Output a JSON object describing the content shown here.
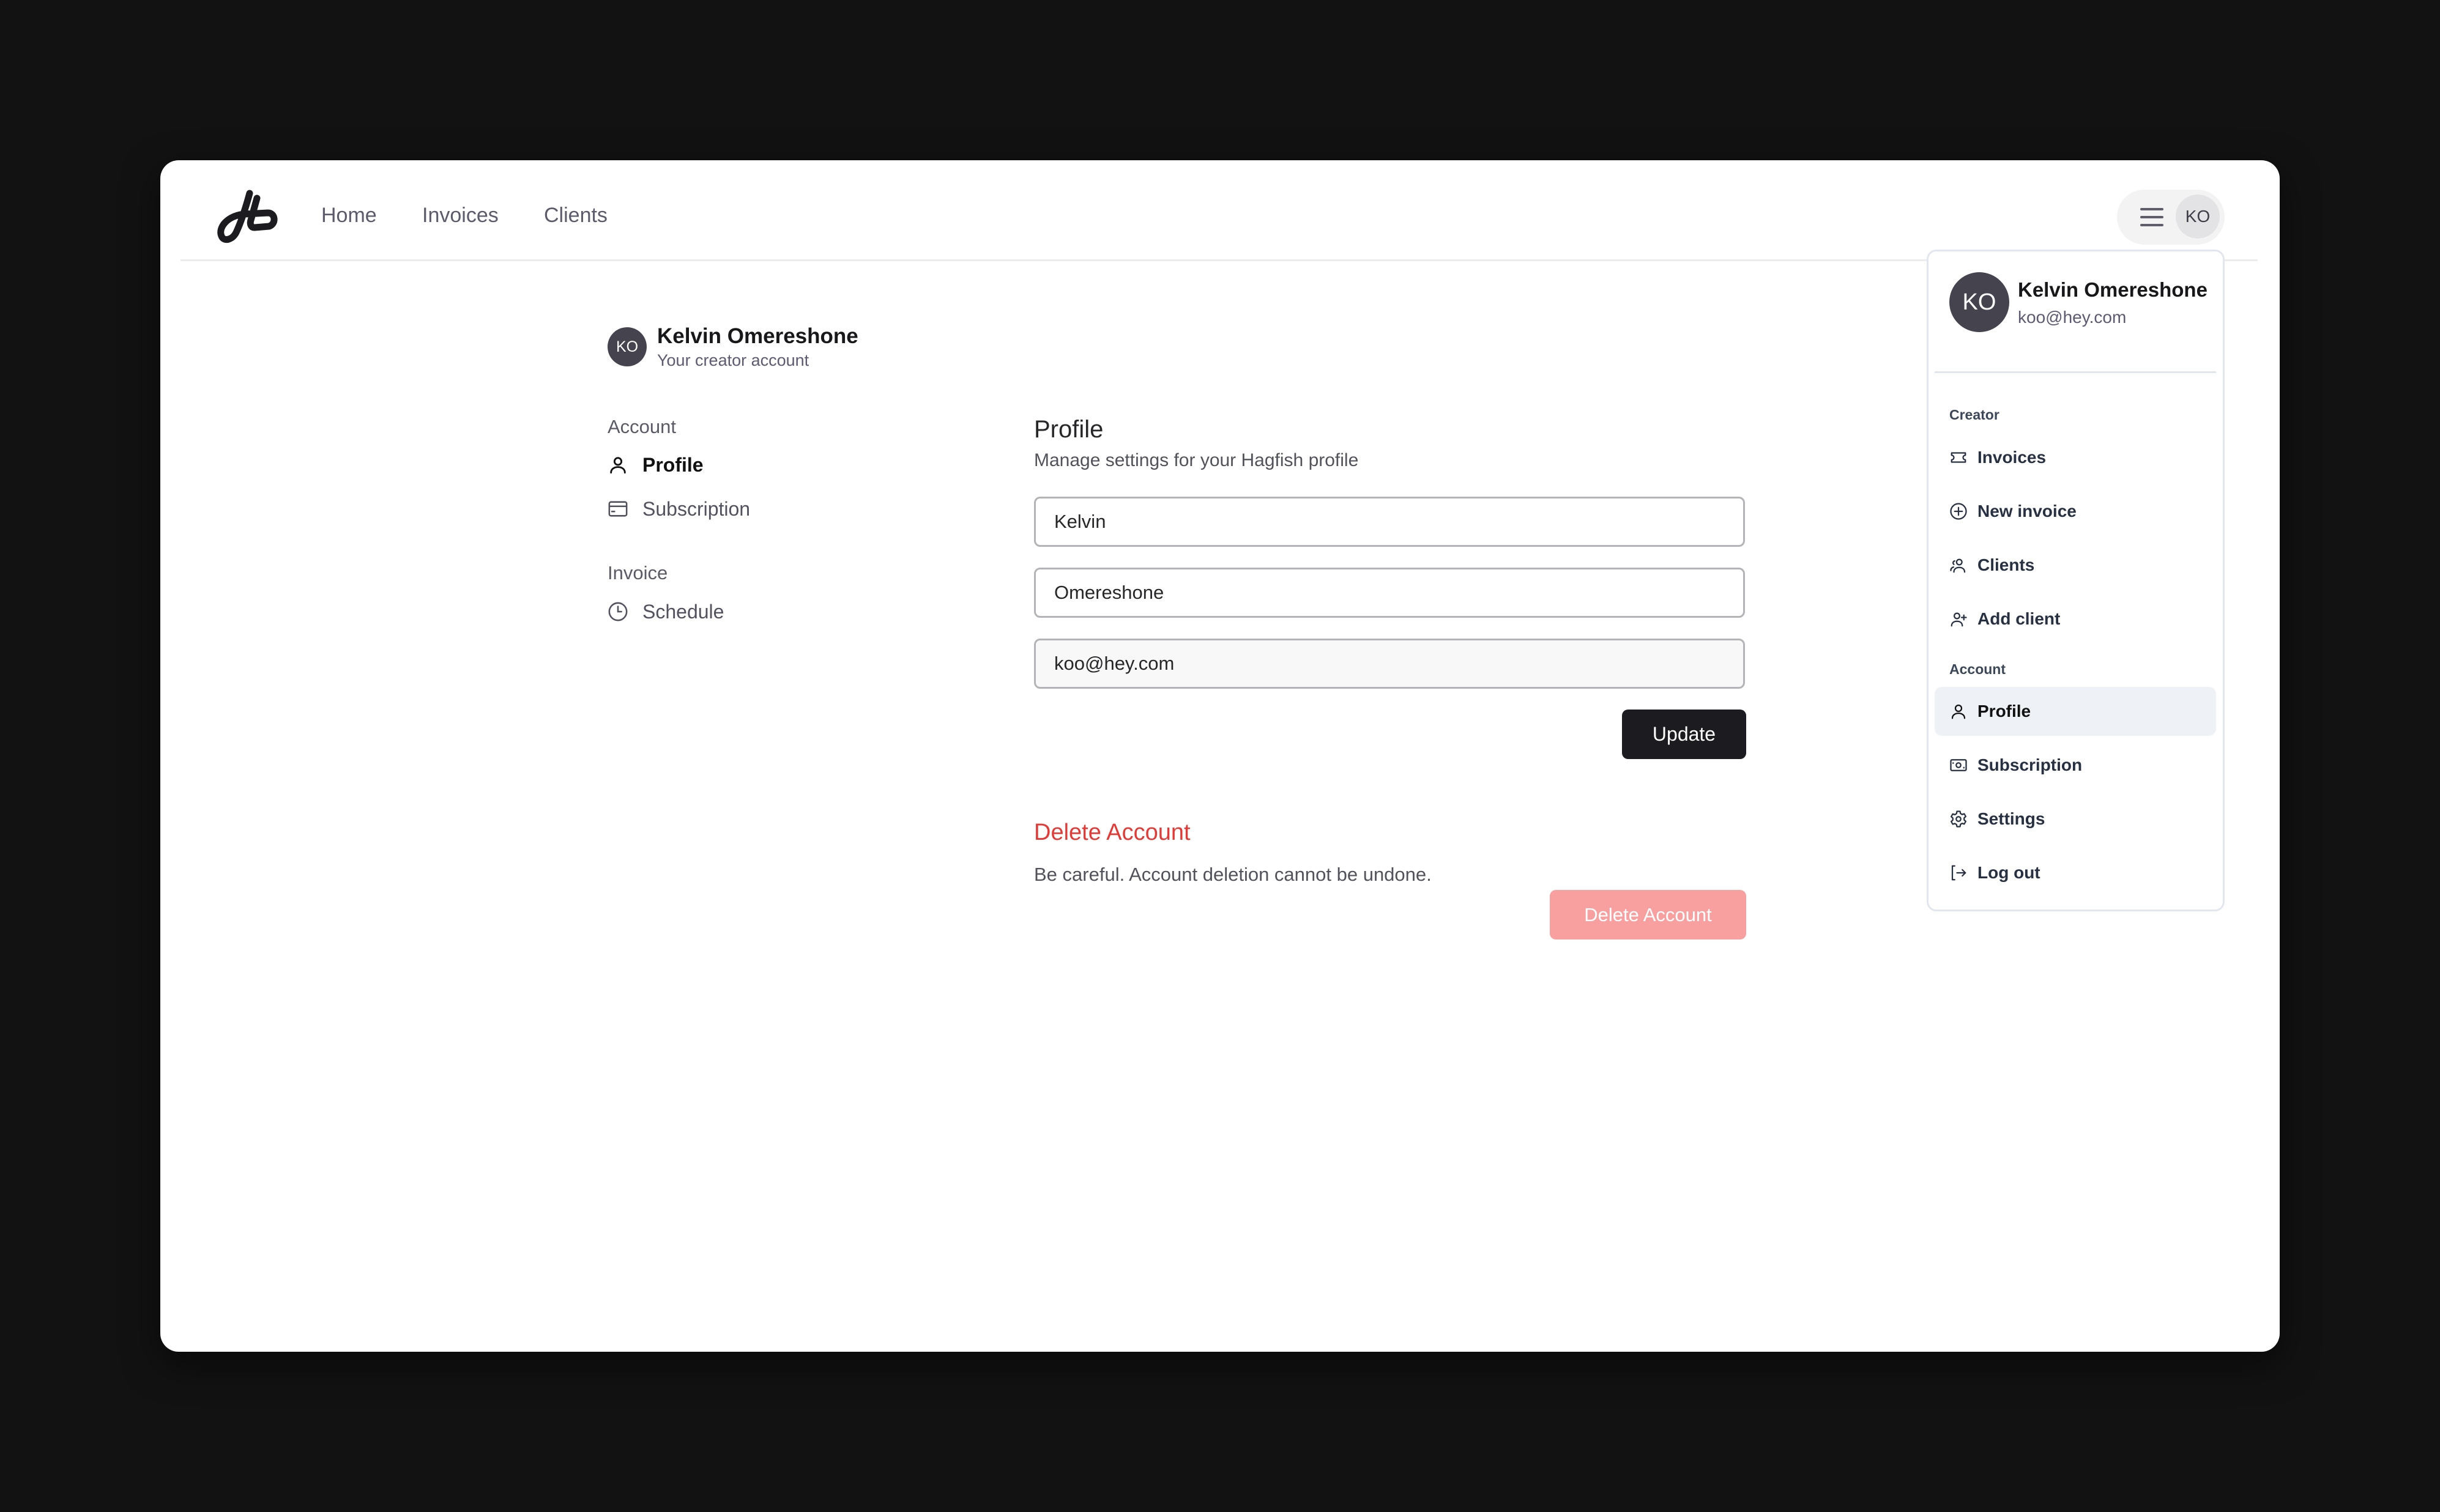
{
  "topnav": {
    "logo": "hagfish-logo",
    "links": [
      {
        "label": "Home"
      },
      {
        "label": "Invoices"
      },
      {
        "label": "Clients"
      }
    ],
    "user_pill": {
      "menu_icon": "hamburger-icon",
      "initials": "KO"
    }
  },
  "account_header": {
    "initials": "KO",
    "name": "Kelvin Omereshone",
    "subtitle": "Your creator account"
  },
  "sidebar": {
    "sections": [
      {
        "label": "Account",
        "items": [
          {
            "label": "Profile",
            "icon": "user-icon",
            "active": true
          },
          {
            "label": "Subscription",
            "icon": "credit-card-icon",
            "active": false
          }
        ]
      },
      {
        "label": "Invoice",
        "items": [
          {
            "label": "Schedule",
            "icon": "clock-icon",
            "active": false
          }
        ]
      }
    ]
  },
  "profile": {
    "title": "Profile",
    "description": "Manage settings for your Hagfish profile",
    "fields": {
      "first_name": "Kelvin",
      "last_name": "Omereshone",
      "email": "koo@hey.com"
    },
    "update_label": "Update"
  },
  "danger_zone": {
    "title": "Delete Account",
    "description": "Be careful. Account deletion cannot be undone.",
    "button_label": "Delete Account"
  },
  "dropdown": {
    "initials": "KO",
    "name": "Kelvin Omereshone",
    "email": "koo@hey.com",
    "sections": [
      {
        "label": "Creator",
        "items": [
          {
            "label": "Invoices",
            "icon": "ticket-icon"
          },
          {
            "label": "New invoice",
            "icon": "plus-circle-icon"
          },
          {
            "label": "Clients",
            "icon": "users-icon"
          },
          {
            "label": "Add client",
            "icon": "user-plus-icon"
          }
        ]
      },
      {
        "label": "Account",
        "items": [
          {
            "label": "Profile",
            "icon": "user-icon",
            "active": true
          },
          {
            "label": "Subscription",
            "icon": "banknote-icon"
          },
          {
            "label": "Settings",
            "icon": "gear-icon"
          },
          {
            "label": "Log out",
            "icon": "logout-icon"
          }
        ]
      }
    ]
  },
  "colors": {
    "background": "#121212",
    "primary_button": "#1c1b1f",
    "danger_text": "#e53935",
    "danger_button_disabled": "#f8a0a0",
    "active_item_bg": "#eef1f6",
    "avatar_dark": "#45434d"
  }
}
